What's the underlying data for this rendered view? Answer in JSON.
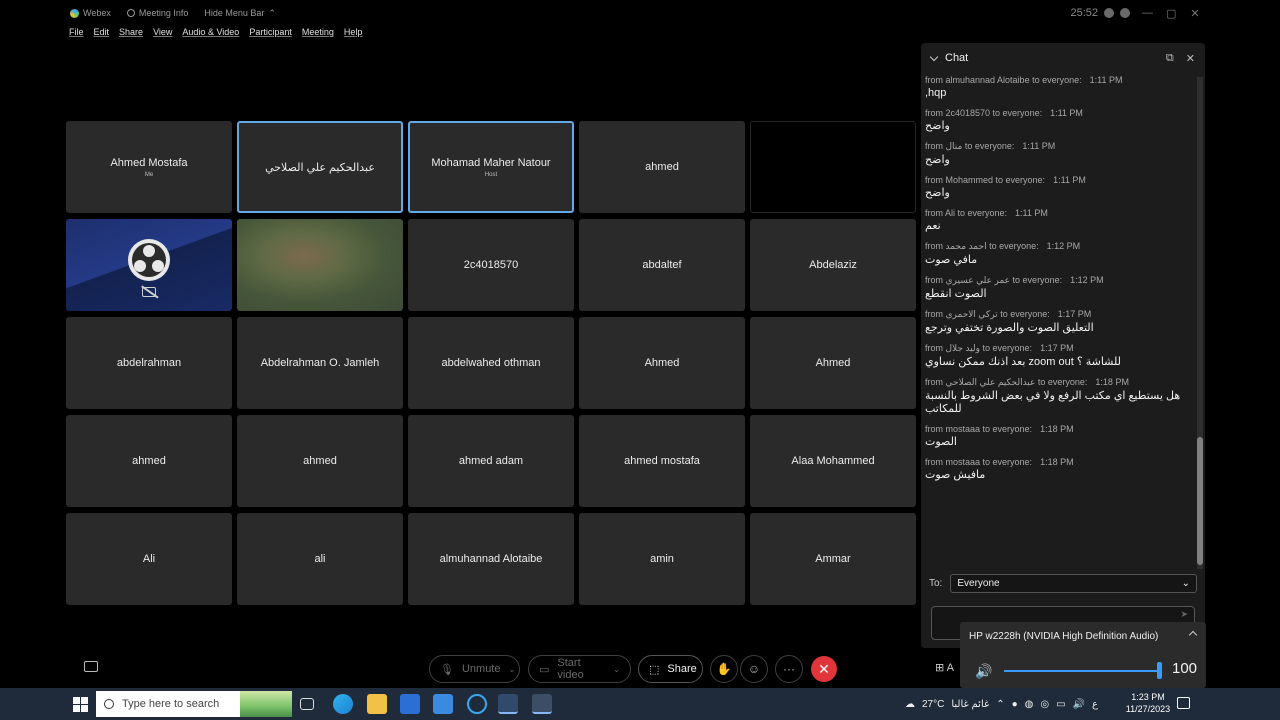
{
  "titlebar": {
    "app_name": "Webex",
    "meeting_info": "Meeting Info",
    "hide_menu_bar": "Hide Menu Bar",
    "timer": "25:52",
    "minimize": "—",
    "restore": "▢",
    "close": "✕"
  },
  "menu": [
    "File",
    "Edit",
    "Share",
    "View",
    "Audio & Video",
    "Participant",
    "Meeting",
    "Help"
  ],
  "participants": [
    {
      "name": "Ahmed Mostafa",
      "sub": "Me",
      "style": "normal"
    },
    {
      "name": "عبدالحكيم علي الصلاحي",
      "sub": "",
      "style": "speaking"
    },
    {
      "name": "Mohamad Maher Natour",
      "sub": "Host",
      "style": "speaking"
    },
    {
      "name": "ahmed",
      "sub": "",
      "style": "normal"
    },
    {
      "name": "",
      "sub": "",
      "style": "blank"
    },
    {
      "name": "",
      "sub": "",
      "style": "obs"
    },
    {
      "name": "",
      "sub": "",
      "style": "photo"
    },
    {
      "name": "2c4018570",
      "sub": "",
      "style": "normal"
    },
    {
      "name": "abdaltef",
      "sub": "",
      "style": "normal"
    },
    {
      "name": "Abdelaziz",
      "sub": "",
      "style": "normal"
    },
    {
      "name": "abdelrahman",
      "sub": "",
      "style": "normal"
    },
    {
      "name": "Abdelrahman O. Jamleh",
      "sub": "",
      "style": "normal"
    },
    {
      "name": "abdelwahed othman",
      "sub": "",
      "style": "normal"
    },
    {
      "name": "Ahmed",
      "sub": "",
      "style": "normal"
    },
    {
      "name": "Ahmed",
      "sub": "",
      "style": "normal"
    },
    {
      "name": "ahmed",
      "sub": "",
      "style": "normal"
    },
    {
      "name": "ahmed",
      "sub": "",
      "style": "normal"
    },
    {
      "name": "ahmed adam",
      "sub": "",
      "style": "normal"
    },
    {
      "name": "ahmed mostafa",
      "sub": "",
      "style": "normal"
    },
    {
      "name": "Alaa Mohammed",
      "sub": "",
      "style": "normal"
    },
    {
      "name": "Ali",
      "sub": "",
      "style": "normal"
    },
    {
      "name": "ali",
      "sub": "",
      "style": "normal"
    },
    {
      "name": "almuhannad Alotaibe",
      "sub": "",
      "style": "normal"
    },
    {
      "name": "amin",
      "sub": "",
      "style": "normal"
    },
    {
      "name": "Ammar",
      "sub": "",
      "style": "normal"
    }
  ],
  "chat": {
    "title": "Chat",
    "popout_icon": "⧉",
    "close_icon": "✕",
    "messages": [
      {
        "from": "from almuhannad Alotaibe to everyone:",
        "time": "1:11 PM",
        "text": ",hqp",
        "rtl": false
      },
      {
        "from": "from 2c4018570 to everyone:",
        "time": "1:11 PM",
        "text": "واضح",
        "rtl": true
      },
      {
        "from": "from منال to everyone:",
        "time": "1:11 PM",
        "text": "واضح",
        "rtl": true
      },
      {
        "from": "from Mohammed to everyone:",
        "time": "1:11 PM",
        "text": "واضح",
        "rtl": true
      },
      {
        "from": "from Ali to everyone:",
        "time": "1:11 PM",
        "text": "نعم",
        "rtl": true
      },
      {
        "from": "from احمد محمد to everyone:",
        "time": "1:12 PM",
        "text": "مافي صوت",
        "rtl": true
      },
      {
        "from": "from عمر علي عسيري to everyone:",
        "time": "1:12 PM",
        "text": "الصوت انقطع",
        "rtl": true
      },
      {
        "from": "from تركي الاحمري to everyone:",
        "time": "1:17 PM",
        "text": "التعليق الصوت والصورة تختفي وترجع",
        "rtl": true
      },
      {
        "from": "from وليد جلال to everyone:",
        "time": "1:17 PM",
        "text": "للشاشة ؟ zoom out بعد اذنك ممكن نساوي",
        "rtl": true
      },
      {
        "from": "from عبدالحكيم علي الصلاحي to everyone:",
        "time": "1:18 PM",
        "text": "هل يستطيع اي مكتب الرفع ولا في بعض الشروط بالنسبة للمكاتب",
        "rtl": true
      },
      {
        "from": "from mostaaa to everyone:",
        "time": "1:18 PM",
        "text": "الصوت",
        "rtl": true
      },
      {
        "from": "from mostaaa to everyone:",
        "time": "1:18 PM",
        "text": "مافيش صوت",
        "rtl": true
      }
    ],
    "to_label": "To:",
    "to_value": "Everyone",
    "send_icon": "➤"
  },
  "audio_popup": {
    "device": "HP w2228h (NVIDIA High Definition Audio)",
    "volume": 100,
    "speaker_icon": "🔊"
  },
  "controls": {
    "unmute": "Unmute",
    "start_video": "Start video",
    "share": "Share",
    "more": "···",
    "end": "✕",
    "apps_label": "A"
  },
  "taskbar": {
    "search_placeholder": "Type here to search",
    "weather": "27°C",
    "weather_text": "غائم غالبا",
    "lang": "ع",
    "time": "1:23 PM",
    "date": "11/27/2023"
  }
}
